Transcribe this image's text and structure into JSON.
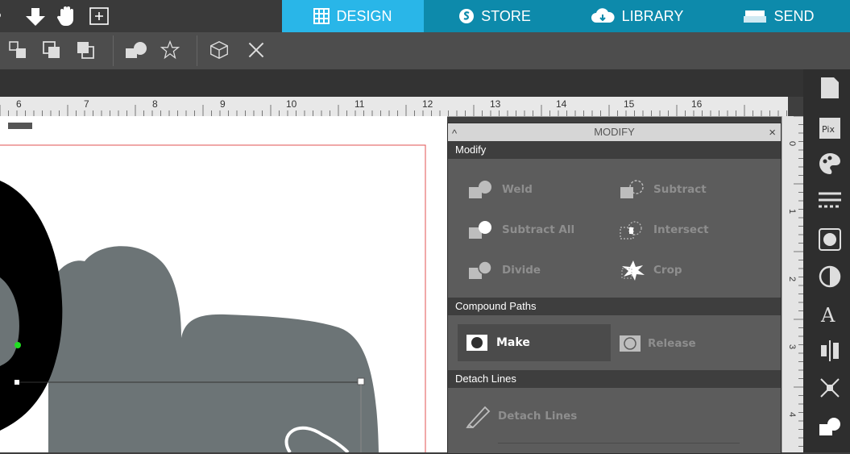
{
  "nav": {
    "tabs": [
      {
        "label": "DESIGN",
        "icon": "grid-icon",
        "active": true
      },
      {
        "label": "STORE",
        "icon": "store-s-icon",
        "active": false
      },
      {
        "label": "LIBRARY",
        "icon": "cloud-icon",
        "active": false
      },
      {
        "label": "SEND",
        "icon": "cutter-icon",
        "active": false
      }
    ],
    "active_color": "#29b6e8",
    "tab_color": "#0d8aab"
  },
  "ruler": {
    "numbers": [
      "6",
      "7",
      "8",
      "9",
      "10",
      "11",
      "12",
      "13",
      "14",
      "15",
      "16"
    ],
    "vertical_numbers": [
      "0",
      "1",
      "2",
      "3",
      "4"
    ]
  },
  "panel": {
    "title": "MODIFY",
    "sections": {
      "modify": "Modify",
      "compound": "Compound Paths",
      "detach": "Detach Lines"
    },
    "buttons": {
      "weld": "Weld",
      "subtract": "Subtract",
      "subtract_all": "Subtract All",
      "intersect": "Intersect",
      "divide": "Divide",
      "crop": "Crop",
      "make": "Make",
      "release": "Release",
      "detach_lines": "Detach Lines"
    }
  },
  "canvas": {
    "shape_fill": "#6c7476",
    "ring_fill": "#000000",
    "cut_border": "#e05050",
    "handle_color": "#22dd22"
  }
}
